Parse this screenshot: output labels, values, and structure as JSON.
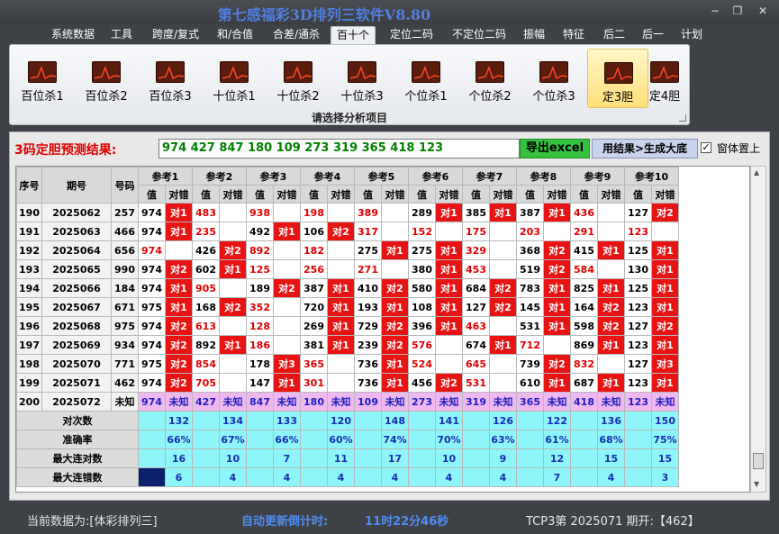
{
  "window": {
    "title": "第七感福彩3D排列三软件V8.80"
  },
  "menu": [
    "系统数据",
    "工具",
    "跨度/复式",
    "和/合值",
    "合差/通杀",
    "百十个",
    "定位二码",
    "不定位二码",
    "振幅",
    "特征",
    "后二",
    "后一",
    "计划"
  ],
  "ribbon": {
    "buttons": [
      "百位杀1",
      "百位杀2",
      "百位杀3",
      "十位杀1",
      "十位杀2",
      "十位杀3",
      "个位杀1",
      "个位杀2",
      "个位杀3",
      "定3胆",
      "定4胆"
    ],
    "caption": "请选择分析项目"
  },
  "prediction": {
    "label": "3码定胆预测结果:",
    "value": "974 427 847 180 109 273 319 365 418 123",
    "excel_button": "导出excel",
    "generate_button": "用结果>生成大底",
    "pin_label": "窗体置上",
    "pin_checked": "✓"
  },
  "table": {
    "headers": {
      "seq": "序号",
      "period": "期号",
      "code": "号码",
      "value": "值",
      "result": "对错",
      "refs": [
        "参考1",
        "参考2",
        "参考3",
        "参考4",
        "参考5",
        "参考6",
        "参考7",
        "参考8",
        "参考9",
        "参考10"
      ]
    },
    "rows": [
      {
        "seq": "190",
        "period": "2025062",
        "code": "257",
        "cells": [
          [
            "974",
            "b",
            "对1"
          ],
          [
            "483",
            "r",
            ""
          ],
          [
            "938",
            "r",
            ""
          ],
          [
            "198",
            "r",
            ""
          ],
          [
            "389",
            "r",
            ""
          ],
          [
            "289",
            "b",
            "对1"
          ],
          [
            "385",
            "b",
            "对1"
          ],
          [
            "387",
            "b",
            "对1"
          ],
          [
            "436",
            "r",
            ""
          ],
          [
            "127",
            "b",
            "对2"
          ]
        ]
      },
      {
        "seq": "191",
        "period": "2025063",
        "code": "466",
        "cells": [
          [
            "974",
            "b",
            "对1"
          ],
          [
            "235",
            "r",
            ""
          ],
          [
            "492",
            "b",
            "对1"
          ],
          [
            "106",
            "b",
            "对2"
          ],
          [
            "317",
            "r",
            ""
          ],
          [
            "152",
            "r",
            ""
          ],
          [
            "175",
            "r",
            ""
          ],
          [
            "203",
            "r",
            ""
          ],
          [
            "291",
            "r",
            ""
          ],
          [
            "123",
            "r",
            ""
          ]
        ]
      },
      {
        "seq": "192",
        "period": "2025064",
        "code": "656",
        "cells": [
          [
            "974",
            "r",
            ""
          ],
          [
            "426",
            "b",
            "对2"
          ],
          [
            "892",
            "r",
            ""
          ],
          [
            "182",
            "r",
            ""
          ],
          [
            "275",
            "b",
            "对1"
          ],
          [
            "275",
            "b",
            "对1"
          ],
          [
            "329",
            "r",
            ""
          ],
          [
            "368",
            "b",
            "对2"
          ],
          [
            "415",
            "b",
            "对1"
          ],
          [
            "125",
            "b",
            "对1"
          ]
        ]
      },
      {
        "seq": "193",
        "period": "2025065",
        "code": "990",
        "cells": [
          [
            "974",
            "b",
            "对2"
          ],
          [
            "602",
            "b",
            "对1"
          ],
          [
            "125",
            "r",
            ""
          ],
          [
            "256",
            "r",
            ""
          ],
          [
            "271",
            "r",
            ""
          ],
          [
            "380",
            "b",
            "对1"
          ],
          [
            "453",
            "r",
            ""
          ],
          [
            "519",
            "b",
            "对2"
          ],
          [
            "584",
            "r",
            ""
          ],
          [
            "130",
            "b",
            "对1"
          ]
        ]
      },
      {
        "seq": "194",
        "period": "2025066",
        "code": "184",
        "cells": [
          [
            "974",
            "b",
            "对1"
          ],
          [
            "905",
            "r",
            ""
          ],
          [
            "189",
            "b",
            "对2"
          ],
          [
            "387",
            "b",
            "对1"
          ],
          [
            "410",
            "b",
            "对2"
          ],
          [
            "580",
            "b",
            "对1"
          ],
          [
            "684",
            "b",
            "对2"
          ],
          [
            "783",
            "b",
            "对1"
          ],
          [
            "825",
            "b",
            "对1"
          ],
          [
            "125",
            "b",
            "对1"
          ]
        ]
      },
      {
        "seq": "195",
        "period": "2025067",
        "code": "671",
        "cells": [
          [
            "975",
            "b",
            "对1"
          ],
          [
            "168",
            "b",
            "对2"
          ],
          [
            "352",
            "r",
            ""
          ],
          [
            "720",
            "b",
            "对1"
          ],
          [
            "193",
            "b",
            "对1"
          ],
          [
            "108",
            "b",
            "对1"
          ],
          [
            "127",
            "b",
            "对2"
          ],
          [
            "145",
            "b",
            "对1"
          ],
          [
            "164",
            "b",
            "对2"
          ],
          [
            "123",
            "b",
            "对1"
          ]
        ]
      },
      {
        "seq": "196",
        "period": "2025068",
        "code": "975",
        "cells": [
          [
            "974",
            "b",
            "对2"
          ],
          [
            "613",
            "r",
            ""
          ],
          [
            "128",
            "r",
            ""
          ],
          [
            "269",
            "b",
            "对1"
          ],
          [
            "729",
            "b",
            "对2"
          ],
          [
            "396",
            "b",
            "对1"
          ],
          [
            "463",
            "r",
            ""
          ],
          [
            "531",
            "b",
            "对1"
          ],
          [
            "598",
            "b",
            "对2"
          ],
          [
            "127",
            "b",
            "对2"
          ]
        ]
      },
      {
        "seq": "197",
        "period": "2025069",
        "code": "934",
        "cells": [
          [
            "974",
            "b",
            "对2"
          ],
          [
            "892",
            "b",
            "对1"
          ],
          [
            "186",
            "r",
            ""
          ],
          [
            "381",
            "b",
            "对1"
          ],
          [
            "239",
            "b",
            "对2"
          ],
          [
            "576",
            "r",
            ""
          ],
          [
            "674",
            "b",
            "对1"
          ],
          [
            "712",
            "r",
            ""
          ],
          [
            "869",
            "b",
            "对1"
          ],
          [
            "123",
            "b",
            "对1"
          ]
        ]
      },
      {
        "seq": "198",
        "period": "2025070",
        "code": "771",
        "cells": [
          [
            "975",
            "b",
            "对2"
          ],
          [
            "854",
            "r",
            ""
          ],
          [
            "178",
            "b",
            "对3"
          ],
          [
            "365",
            "r",
            ""
          ],
          [
            "736",
            "b",
            "对1"
          ],
          [
            "524",
            "r",
            ""
          ],
          [
            "645",
            "r",
            ""
          ],
          [
            "739",
            "b",
            "对2"
          ],
          [
            "832",
            "r",
            ""
          ],
          [
            "127",
            "b",
            "对3"
          ]
        ]
      },
      {
        "seq": "199",
        "period": "2025071",
        "code": "462",
        "cells": [
          [
            "974",
            "b",
            "对2"
          ],
          [
            "705",
            "r",
            ""
          ],
          [
            "147",
            "b",
            "对1"
          ],
          [
            "301",
            "r",
            ""
          ],
          [
            "736",
            "b",
            "对1"
          ],
          [
            "456",
            "b",
            "对2"
          ],
          [
            "531",
            "r",
            ""
          ],
          [
            "610",
            "b",
            "对1"
          ],
          [
            "687",
            "b",
            "对1"
          ],
          [
            "123",
            "b",
            "对1"
          ]
        ]
      }
    ],
    "unknown_row": {
      "seq": "200",
      "period": "2025072",
      "code": "未知",
      "values": [
        "974",
        "427",
        "847",
        "180",
        "109",
        "273",
        "319",
        "365",
        "418",
        "123"
      ],
      "unknown": "未知"
    },
    "stats": [
      {
        "label": "对次数",
        "values": [
          "132",
          "134",
          "133",
          "120",
          "148",
          "141",
          "126",
          "122",
          "136",
          "150"
        ]
      },
      {
        "label": "准确率",
        "values": [
          "66%",
          "67%",
          "66%",
          "60%",
          "74%",
          "70%",
          "63%",
          "61%",
          "68%",
          "75%"
        ]
      },
      {
        "label": "最大连对数",
        "values": [
          "16",
          "10",
          "7",
          "11",
          "17",
          "10",
          "9",
          "12",
          "15",
          "15"
        ]
      },
      {
        "label": "最大连错数",
        "values": [
          "6",
          "4",
          "4",
          "4",
          "4",
          "4",
          "4",
          "7",
          "4",
          "3"
        ]
      }
    ]
  },
  "status": {
    "current_data": "当前数据为:[体彩排列三]",
    "countdown_label": "自动更新倒计时:",
    "countdown_value": "11时22分46秒",
    "tcp3": "TCP3第 2025071 期开:【462】"
  },
  "colors": {
    "hit": "#e81414",
    "miss_text": "#e00000",
    "stat_bg": "#8ef6fb",
    "unknown_bg": "#f0b8f0",
    "title": "#4f7fe0"
  }
}
